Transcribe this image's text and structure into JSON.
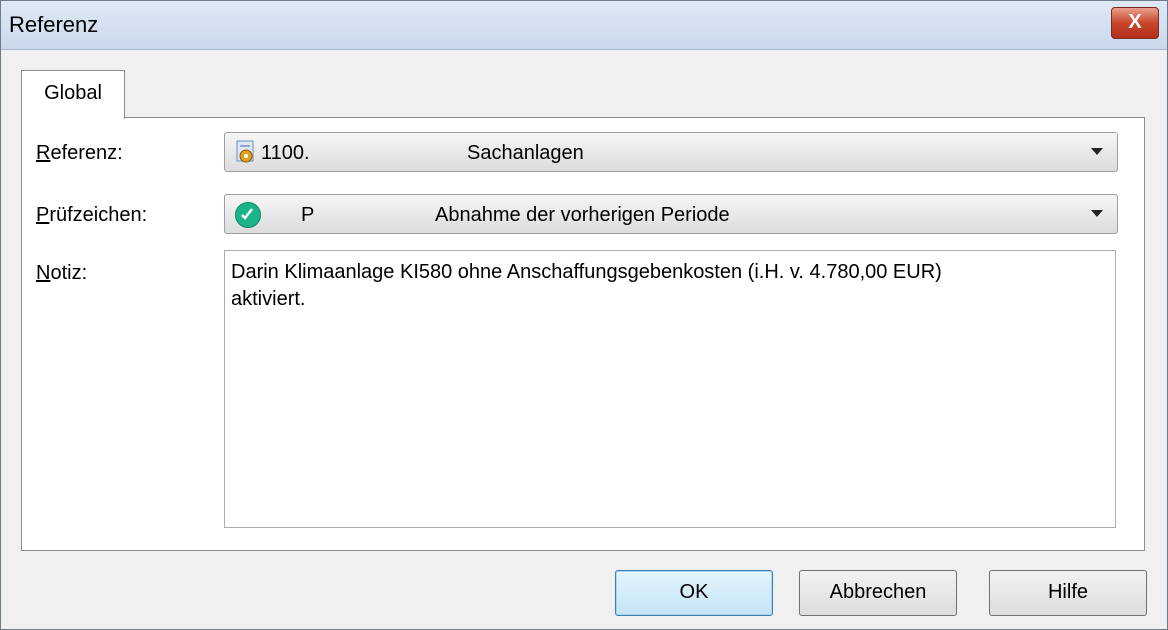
{
  "window": {
    "title": "Referenz",
    "close_glyph": "X"
  },
  "tabs": [
    {
      "label": "Global"
    }
  ],
  "form": {
    "referenz": {
      "label_first": "R",
      "label_rest": "eferenz:",
      "icon": "folder-gear-icon",
      "code": "1100.",
      "text": "Sachanlagen"
    },
    "pruefzeichen": {
      "label_first": "P",
      "label_rest": "rüfzeichen:",
      "icon": "check-circle-icon",
      "code": "P",
      "text": "Abnahme der vorherigen Periode",
      "icon_color": "#1bb38a"
    },
    "notiz": {
      "label_first": "N",
      "label_rest": "otiz:",
      "value": "Darin Klimaanlage KI580 ohne Anschaffungsgebenkosten (i.H. v. 4.780,00 EUR)\naktiviert."
    }
  },
  "buttons": {
    "ok": "OK",
    "cancel": "Abbrechen",
    "help": "Hilfe"
  }
}
